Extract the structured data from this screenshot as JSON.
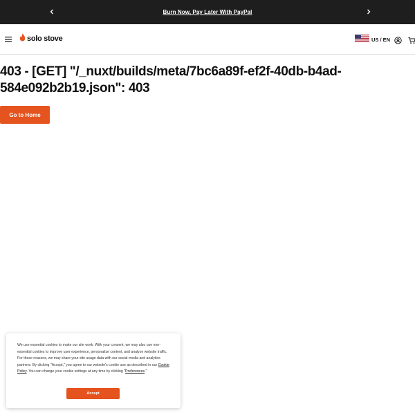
{
  "promo_bar": {
    "text": "Burn Now, Pay Later With PayPal",
    "prev_icon": "chevron-left-icon",
    "next_icon": "chevron-right-icon",
    "background": "#1e1e1e"
  },
  "header": {
    "menu_icon": "hamburger-menu-icon",
    "logo_text": "solo stove",
    "logo_icon": "flame-icon",
    "locale_label": "US / EN",
    "flag_icon": "us-flag-icon",
    "account_icon": "account-icon",
    "cart_icon": "cart-icon"
  },
  "main": {
    "error_title": "403 - [GET] \"/_nuxt/builds/meta/7bc6a89f-ef2f-40db-b4ad-584e092b2b19.json\": 403",
    "home_button_label": "Go to Home"
  },
  "cookie_banner": {
    "text_part1": "We use essential cookies to make our site work. With your consent, we may also use non-essential cookies to improve user experience, personalize content, and analyze website traffic. For these reasons, we may share your site usage data with our social media and analytics partners. By clicking \"Accept,\" you agree to our website's cookie use as described in our ",
    "cookie_policy_link": "Cookie Policy",
    "text_part2": ". You can change your cookie settings at any time by clicking \"",
    "preferences_link": "Preferences",
    "text_part3": ".\"",
    "accept_label": "Accept"
  },
  "colors": {
    "accent": "#e5531e",
    "dark": "#1e1e1e"
  }
}
